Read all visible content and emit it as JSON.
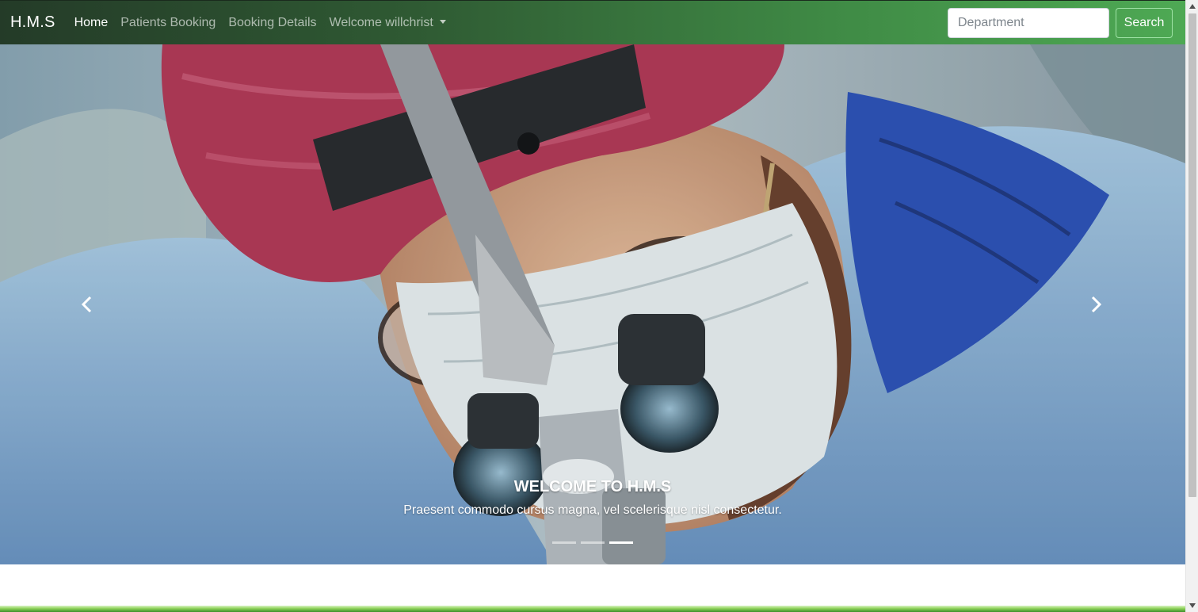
{
  "navbar": {
    "brand": "H.M.S",
    "links": [
      {
        "label": "Home",
        "active": true
      },
      {
        "label": "Patients Booking",
        "active": false
      },
      {
        "label": "Booking Details",
        "active": false
      },
      {
        "label": "Welcome willchrist",
        "active": false,
        "dropdown": true
      }
    ],
    "search": {
      "placeholder": "Department",
      "value": "",
      "button_label": "Search"
    },
    "colors": {
      "start": "#243b28",
      "end": "#4ea954"
    }
  },
  "carousel": {
    "slide_image": "surgeon-with-loupes-photo",
    "caption_title": "WELCOME TO H.M.S",
    "caption_text": "Praesent commodo cursus magna, vel scelerisque nisl consectetur.",
    "indicator_count": 3,
    "active_indicator": 3,
    "prev_icon": "chevron-left-icon",
    "next_icon": "chevron-right-icon"
  }
}
